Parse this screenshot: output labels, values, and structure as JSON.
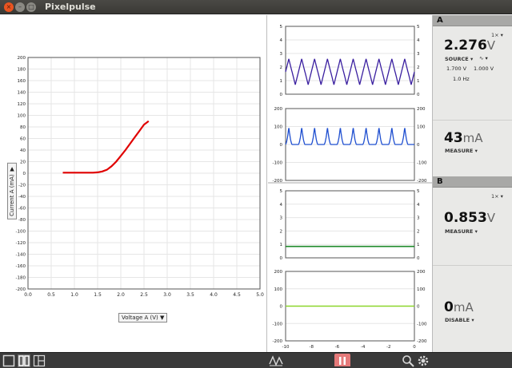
{
  "window": {
    "title": "Pixelpulse",
    "close_glyph": "×",
    "min_glyph": "–",
    "max_glyph": "□"
  },
  "main_plot": {
    "x_axis_select": "Voltage A (V) ▼",
    "y_axis_select": "Current A (mA) ▼",
    "xticks": [
      "0.0",
      "0.5",
      "1.0",
      "1.5",
      "2.0",
      "2.5",
      "3.0",
      "3.5",
      "4.0",
      "4.5",
      "5.0"
    ],
    "yticks": [
      "200",
      "180",
      "160",
      "140",
      "120",
      "100",
      "80",
      "60",
      "40",
      "20",
      "0",
      "-20",
      "-40",
      "-60",
      "-80",
      "-100",
      "-120",
      "-140",
      "-160",
      "-180",
      "-200"
    ],
    "trace_color": "#e00000"
  },
  "strip_plots": {
    "voltage_ticks": [
      "5",
      "4",
      "3",
      "2",
      "1",
      "0"
    ],
    "current_ticks": [
      "200",
      "100",
      "0",
      "-100",
      "-200"
    ],
    "time_ticks": [
      "-10",
      "-8",
      "-6",
      "-4",
      "-2",
      "0"
    ],
    "colors": {
      "a_voltage": "#3a1fa0",
      "a_current": "#1f4fd0",
      "b_voltage": "#1e8a2a",
      "b_current": "#8bd62a"
    }
  },
  "channel_a": {
    "letter": "A",
    "scale": "1×  ▾",
    "source_value": "2.276",
    "source_unit": "V",
    "source_mode": "SOURCE ▾",
    "wave_icon": "∿ ▾",
    "param_low": "1.700 V",
    "param_high": "1.000 V",
    "param_freq": "1.0 Hz",
    "measure_value": "43",
    "measure_unit": "mA",
    "measure_mode": "MEASURE ▾"
  },
  "channel_b": {
    "letter": "B",
    "scale": "1×  ▾",
    "measure_value": "0.853",
    "measure_unit": "V",
    "measure_mode": "MEASURE ▾",
    "disable_value": "0",
    "disable_unit": "mA",
    "disable_mode": "DISABLE ▾"
  },
  "chart_data": {
    "type": "line",
    "title": "",
    "xlabel": "Voltage A (V)",
    "ylabel": "Current A (mA)",
    "xlim": [
      0,
      5
    ],
    "ylim": [
      -200,
      200
    ],
    "series": [
      {
        "x": [
          0.75,
          1.0,
          1.2,
          1.4,
          1.5,
          1.6,
          1.7,
          1.8,
          1.9,
          2.0,
          2.1,
          2.2,
          2.3,
          2.4,
          2.5,
          2.6
        ],
        "values": [
          1,
          1,
          1,
          1,
          1.5,
          3,
          6,
          12,
          20,
          30,
          40,
          51,
          62,
          73,
          84,
          90
        ]
      }
    ]
  }
}
